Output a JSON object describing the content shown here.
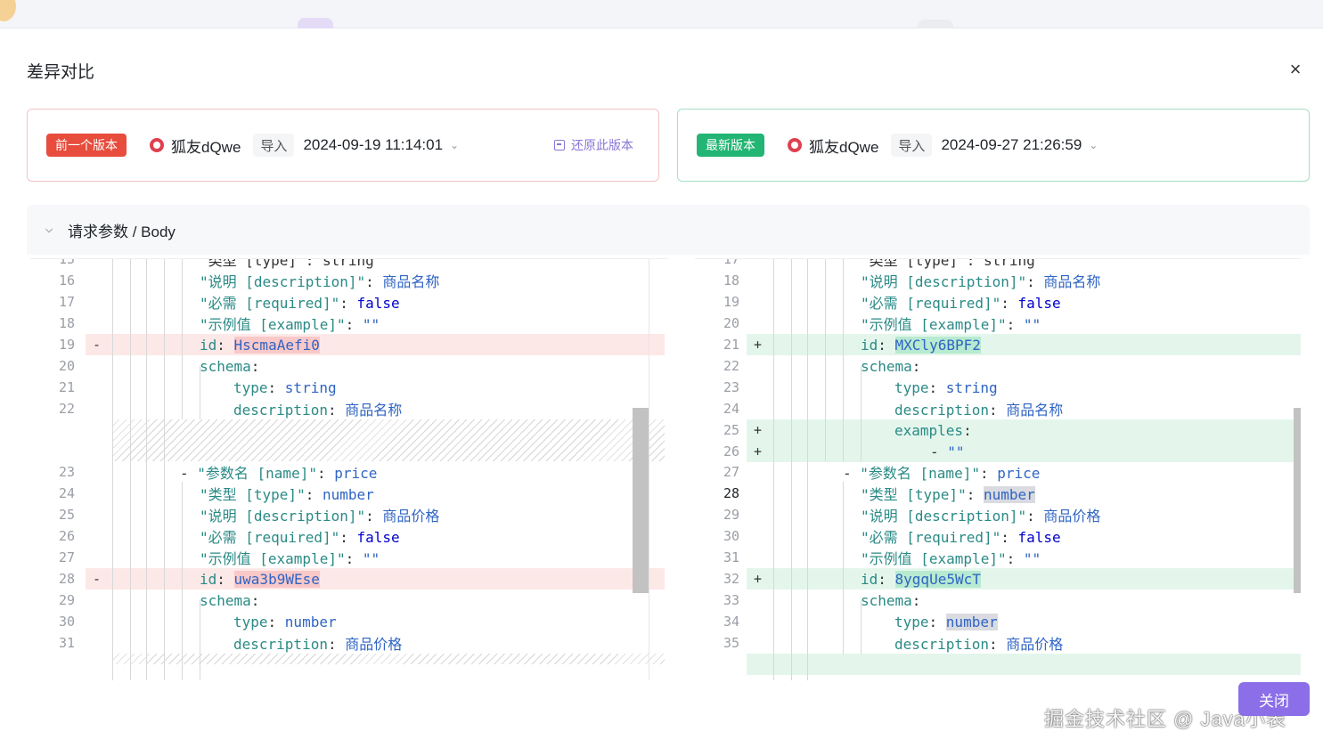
{
  "modal": {
    "title": "差异对比",
    "close_glyph": "×"
  },
  "prev": {
    "badge": "前一个版本",
    "user": "狐友dQwe",
    "action": "导入",
    "time": "2024-09-19 11:14:01",
    "restore_label": "还原此版本"
  },
  "latest": {
    "badge": "最新版本",
    "user": "狐友dQwe",
    "action": "导入",
    "time": "2024-09-27 21:26:59"
  },
  "section": {
    "title": "请求参数 / Body"
  },
  "left_lines": [
    {
      "n": "15",
      "parts": [
        [
          "p",
          "\"类型 [type]\": string"
        ]
      ]
    },
    {
      "n": "16",
      "parts": [
        [
          "s",
          "\"说明 [description]\""
        ],
        [
          "p",
          ": "
        ],
        [
          "cn",
          "商品名称"
        ]
      ]
    },
    {
      "n": "17",
      "parts": [
        [
          "s",
          "\"必需 [required]\""
        ],
        [
          "p",
          ": "
        ],
        [
          "b",
          "false"
        ]
      ]
    },
    {
      "n": "18",
      "parts": [
        [
          "s",
          "\"示例值 [example]\""
        ],
        [
          "p",
          ": "
        ],
        [
          "v",
          "\"\""
        ]
      ]
    },
    {
      "n": "19",
      "parts": [
        [
          "k",
          "id"
        ],
        [
          "p",
          ": "
        ],
        [
          "v",
          "HscmaAefi0"
        ]
      ]
    },
    {
      "n": "20",
      "parts": [
        [
          "k",
          "schema"
        ],
        [
          "p",
          ":"
        ]
      ]
    },
    {
      "n": "21",
      "parts": [
        [
          "k",
          "type"
        ],
        [
          "p",
          ": "
        ],
        [
          "v",
          "string"
        ]
      ]
    },
    {
      "n": "22",
      "parts": [
        [
          "k",
          "description"
        ],
        [
          "p",
          ": "
        ],
        [
          "cn",
          "商品名称"
        ]
      ]
    },
    {
      "n": "23",
      "parts": [
        [
          "p",
          "- "
        ],
        [
          "s",
          "\"参数名 [name]\""
        ],
        [
          "p",
          ": "
        ],
        [
          "v",
          "price"
        ]
      ]
    },
    {
      "n": "24",
      "parts": [
        [
          "s",
          "\"类型 [type]\""
        ],
        [
          "p",
          ": "
        ],
        [
          "v",
          "number"
        ]
      ]
    },
    {
      "n": "25",
      "parts": [
        [
          "s",
          "\"说明 [description]\""
        ],
        [
          "p",
          ": "
        ],
        [
          "cn",
          "商品价格"
        ]
      ]
    },
    {
      "n": "26",
      "parts": [
        [
          "s",
          "\"必需 [required]\""
        ],
        [
          "p",
          ": "
        ],
        [
          "b",
          "false"
        ]
      ]
    },
    {
      "n": "27",
      "parts": [
        [
          "s",
          "\"示例值 [example]\""
        ],
        [
          "p",
          ": "
        ],
        [
          "v",
          "\"\""
        ]
      ]
    },
    {
      "n": "28",
      "parts": [
        [
          "k",
          "id"
        ],
        [
          "p",
          ": "
        ],
        [
          "v",
          "uwa3b9WEse"
        ]
      ]
    },
    {
      "n": "29",
      "parts": [
        [
          "k",
          "schema"
        ],
        [
          "p",
          ":"
        ]
      ]
    },
    {
      "n": "30",
      "parts": [
        [
          "k",
          "type"
        ],
        [
          "p",
          ": "
        ],
        [
          "v",
          "number"
        ]
      ]
    },
    {
      "n": "31",
      "parts": [
        [
          "k",
          "description"
        ],
        [
          "p",
          ": "
        ],
        [
          "cn",
          "商品价格"
        ]
      ]
    }
  ],
  "right_lines": [
    {
      "n": "17",
      "parts": [
        [
          "p",
          "\"类型 [type]\": string"
        ]
      ]
    },
    {
      "n": "18",
      "parts": [
        [
          "s",
          "\"说明 [description]\""
        ],
        [
          "p",
          ": "
        ],
        [
          "cn",
          "商品名称"
        ]
      ]
    },
    {
      "n": "19",
      "parts": [
        [
          "s",
          "\"必需 [required]\""
        ],
        [
          "p",
          ": "
        ],
        [
          "b",
          "false"
        ]
      ]
    },
    {
      "n": "20",
      "parts": [
        [
          "s",
          "\"示例值 [example]\""
        ],
        [
          "p",
          ": "
        ],
        [
          "v",
          "\"\""
        ]
      ]
    },
    {
      "n": "21",
      "parts": [
        [
          "k",
          "id"
        ],
        [
          "p",
          ": "
        ],
        [
          "v",
          "MXCly6BPF2"
        ]
      ]
    },
    {
      "n": "22",
      "parts": [
        [
          "k",
          "schema"
        ],
        [
          "p",
          ":"
        ]
      ]
    },
    {
      "n": "23",
      "parts": [
        [
          "k",
          "type"
        ],
        [
          "p",
          ": "
        ],
        [
          "v",
          "string"
        ]
      ]
    },
    {
      "n": "24",
      "parts": [
        [
          "k",
          "description"
        ],
        [
          "p",
          ": "
        ],
        [
          "cn",
          "商品名称"
        ]
      ]
    },
    {
      "n": "25",
      "parts": [
        [
          "k",
          "examples"
        ],
        [
          "p",
          ":"
        ]
      ]
    },
    {
      "n": "26",
      "parts": [
        [
          "p",
          "- "
        ],
        [
          "v",
          "\"\""
        ]
      ]
    },
    {
      "n": "27",
      "parts": [
        [
          "p",
          "- "
        ],
        [
          "s",
          "\"参数名 [name]\""
        ],
        [
          "p",
          ": "
        ],
        [
          "v",
          "price"
        ]
      ]
    },
    {
      "n": "28",
      "parts": [
        [
          "s",
          "\"类型 [type]\""
        ],
        [
          "p",
          ": "
        ],
        [
          "v",
          "number"
        ]
      ]
    },
    {
      "n": "29",
      "parts": [
        [
          "s",
          "\"说明 [description]\""
        ],
        [
          "p",
          ": "
        ],
        [
          "cn",
          "商品价格"
        ]
      ]
    },
    {
      "n": "30",
      "parts": [
        [
          "s",
          "\"必需 [required]\""
        ],
        [
          "p",
          ": "
        ],
        [
          "b",
          "false"
        ]
      ]
    },
    {
      "n": "31",
      "parts": [
        [
          "s",
          "\"示例值 [example]\""
        ],
        [
          "p",
          ": "
        ],
        [
          "v",
          "\"\""
        ]
      ]
    },
    {
      "n": "32",
      "parts": [
        [
          "k",
          "id"
        ],
        [
          "p",
          ": "
        ],
        [
          "v",
          "8ygqUe5WcT"
        ]
      ]
    },
    {
      "n": "33",
      "parts": [
        [
          "k",
          "schema"
        ],
        [
          "p",
          ":"
        ]
      ]
    },
    {
      "n": "34",
      "parts": [
        [
          "k",
          "type"
        ],
        [
          "p",
          ": "
        ],
        [
          "v",
          "number"
        ]
      ]
    },
    {
      "n": "35",
      "parts": [
        [
          "k",
          "description"
        ],
        [
          "p",
          ": "
        ],
        [
          "cn",
          "商品价格"
        ]
      ]
    }
  ],
  "diff_marks": {
    "removed": "-",
    "added": "+"
  },
  "footer": {
    "close_label": "关闭",
    "watermark": "掘金技术社区 @ Java小表"
  },
  "colors": {
    "accent": "#8b6ee8",
    "removed_bg": "#fde8e8",
    "added_bg": "#e4f6ec",
    "prev_badge": "#e74c3c",
    "latest_badge": "#22b573"
  }
}
